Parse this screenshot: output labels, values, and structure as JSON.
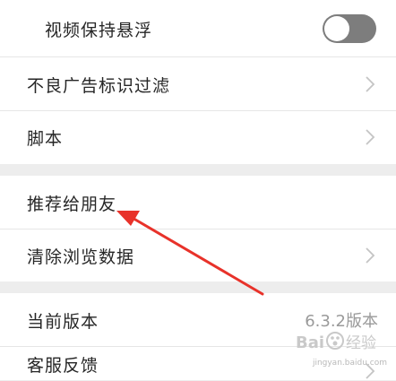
{
  "settings": {
    "group1": {
      "video_float": {
        "label": "视频保持悬浮",
        "toggle_on": false
      },
      "ad_filter": {
        "label": "不良广告标识过滤"
      },
      "script": {
        "label": "脚本"
      }
    },
    "group2": {
      "recommend": {
        "label": "推荐给朋友"
      },
      "clear_data": {
        "label": "清除浏览数据"
      }
    },
    "group3": {
      "version": {
        "label": "当前版本",
        "value": "6.3.2版本"
      },
      "feedback": {
        "label": "客服反馈"
      }
    }
  },
  "annotation": {
    "arrow_color": "#e8322a"
  },
  "watermark": {
    "logo_text": "Baidu经验",
    "url": "jingyan.baidu.com"
  },
  "colors": {
    "background": "#ededed",
    "row": "#ffffff",
    "toggle_off": "#7d7d7d",
    "chevron": "#c4c4c4"
  }
}
